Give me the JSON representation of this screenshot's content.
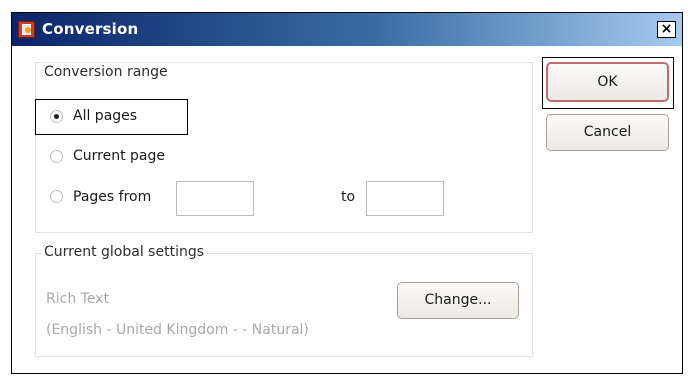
{
  "window": {
    "title": "Conversion",
    "close_glyph": "×"
  },
  "conversion_range": {
    "label": "Conversion range",
    "options": [
      {
        "label": "All pages",
        "checked": true
      },
      {
        "label": "Current page",
        "checked": false
      },
      {
        "label": "Pages from",
        "checked": false
      }
    ],
    "from_value": "",
    "to_label": "to",
    "to_value": ""
  },
  "global_settings": {
    "label": "Current global settings",
    "format": "Rich Text",
    "details": "(English - United Kingdom -  - Natural)",
    "change_label": "Change..."
  },
  "buttons": {
    "ok_label": "OK",
    "cancel_label": "Cancel"
  },
  "colors": {
    "titlebar_start": "#0a246a",
    "titlebar_end": "#a6caf0",
    "default_button_border": "#c46c6c",
    "disabled_text": "#a8a8a8"
  }
}
